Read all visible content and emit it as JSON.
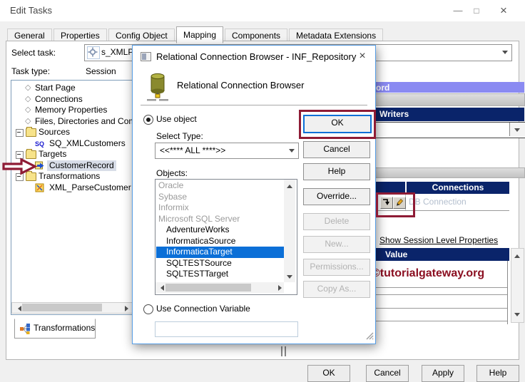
{
  "window": {
    "title": "Edit Tasks"
  },
  "tabs": {
    "active": "Mapping",
    "items": [
      {
        "label": "General"
      },
      {
        "label": "Properties"
      },
      {
        "label": "Config Object"
      },
      {
        "label": "Mapping"
      },
      {
        "label": "Components"
      },
      {
        "label": "Metadata Extensions"
      }
    ]
  },
  "form": {
    "select_task_label": "Select task:",
    "select_task_value": "s_XMLP",
    "task_type_label": "Task type:",
    "task_type_value": "Session"
  },
  "tree": {
    "items": [
      {
        "label": "Start Page",
        "type": "category"
      },
      {
        "label": "Connections",
        "type": "category"
      },
      {
        "label": "Memory Properties",
        "type": "category"
      },
      {
        "label": "Files, Directories and Com",
        "type": "category"
      },
      {
        "label": "Sources",
        "type": "folder"
      },
      {
        "label": "SQ_XMLCustomers",
        "type": "child",
        "icon": "source-qualifier-icon"
      },
      {
        "label": "Targets",
        "type": "folder"
      },
      {
        "label": "CustomerRecord",
        "type": "child",
        "icon": "target-icon",
        "selected": true,
        "annotated": true
      },
      {
        "label": "Transformations",
        "type": "folder"
      },
      {
        "label": "XML_ParseCustomer",
        "type": "child",
        "icon": "transformation-icon"
      }
    ]
  },
  "bottom_tab": {
    "label": "Transformations"
  },
  "right_panel": {
    "record_header_fragment": "ord",
    "writers_header": "Writers",
    "connections_header": "Connections",
    "connection_placeholder": "DB Connection",
    "session_link": "Show Session Level Properties",
    "value_header": "Value",
    "watermark": "©tutorialgateway.org"
  },
  "dialog": {
    "title": "Relational Connection Browser - INF_Repository",
    "heading": "Relational Connection Browser",
    "use_object_label": "Use object",
    "select_type_label": "Select Type:",
    "select_type_value": "<<**** ALL ****>>",
    "objects_label": "Objects:",
    "objects": [
      {
        "label": "Oracle",
        "kind": "group"
      },
      {
        "label": "Sybase",
        "kind": "group"
      },
      {
        "label": "Informix",
        "kind": "group"
      },
      {
        "label": "Microsoft SQL Server",
        "kind": "group"
      },
      {
        "label": "AdventureWorks",
        "kind": "item"
      },
      {
        "label": "InformaticaSource",
        "kind": "item"
      },
      {
        "label": "InformaticaTarget",
        "kind": "item",
        "selected": true
      },
      {
        "label": "SQLTESTSource",
        "kind": "item"
      },
      {
        "label": "SQLTESTTarget",
        "kind": "item"
      }
    ],
    "use_variable_label": "Use Connection Variable",
    "variable_value": "",
    "buttons": [
      {
        "label": "OK",
        "enabled": true,
        "focused": true,
        "annotated": true
      },
      {
        "label": "Cancel",
        "enabled": true
      },
      {
        "label": "Help",
        "enabled": true
      },
      {
        "label": "Override...",
        "enabled": true
      },
      {
        "label": "Delete",
        "enabled": false
      },
      {
        "label": "New...",
        "enabled": false
      },
      {
        "label": "Permissions...",
        "enabled": false
      },
      {
        "label": "Copy As...",
        "enabled": false
      }
    ]
  },
  "footer": {
    "buttons": [
      "OK",
      "Cancel",
      "Apply",
      "Help"
    ]
  },
  "colors": {
    "navy": "#0a246a",
    "record_purple": "#8a8af2",
    "selection_blue": "#0b6fd7",
    "annotation_red": "#8e1b35",
    "watermark_red": "#8b0f21"
  }
}
